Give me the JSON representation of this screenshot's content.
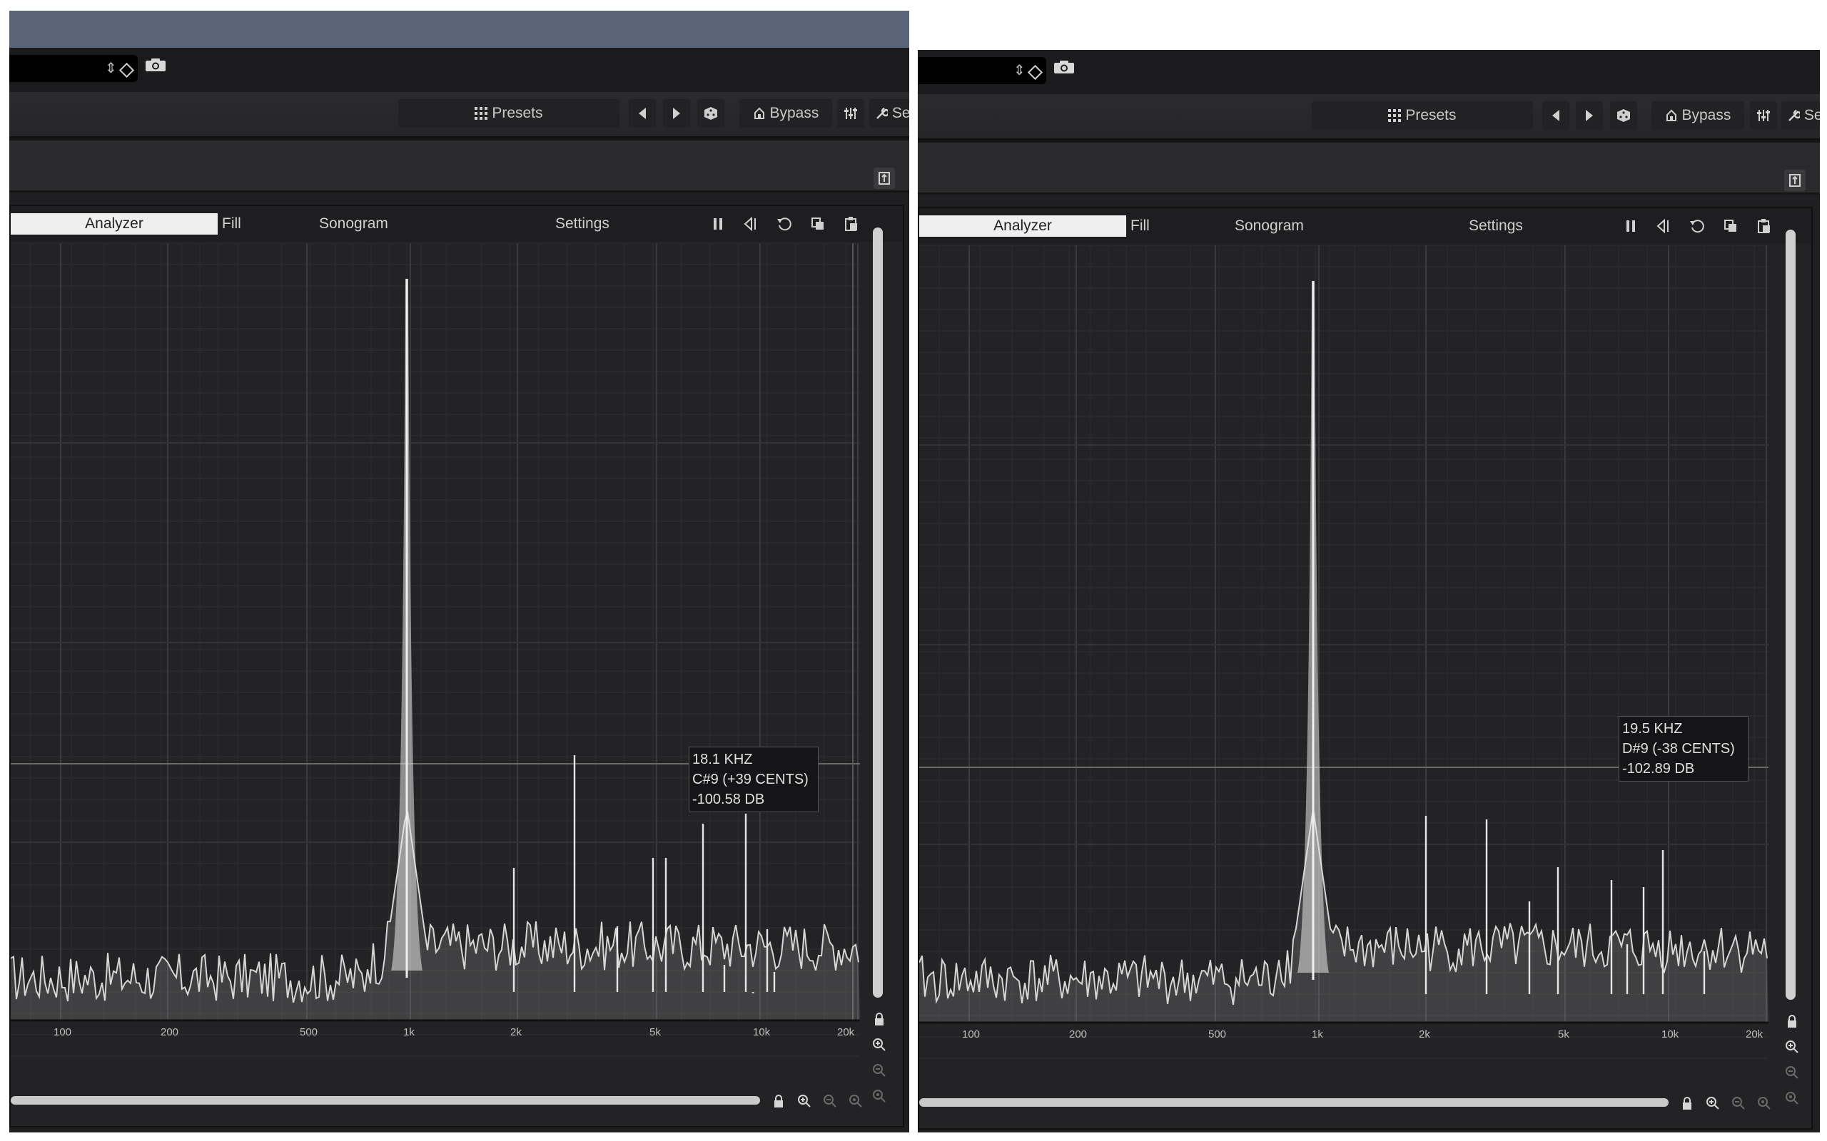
{
  "toolbar": {
    "presets_label": "Presets",
    "bypass_label": "Bypass",
    "settings_short_label": "Set",
    "settings_short_label_right": "Se"
  },
  "tabs": {
    "analyzer": "Analyzer",
    "fill": "Fill",
    "sonogram": "Sonogram",
    "settings": "Settings"
  },
  "x_axis_labels": [
    "100",
    "200",
    "500",
    "1k",
    "2k",
    "5k",
    "10k",
    "20k"
  ],
  "left_panel": {
    "readout": {
      "freq": "18.1 KHZ",
      "note": "C#9 (+39 CENTS)",
      "level": "-100.58 DB"
    }
  },
  "right_panel": {
    "readout": {
      "freq": "19.5 KHZ",
      "note": "D#9 (-38 CENTS)",
      "level": "-102.89 DB"
    }
  },
  "colors": {
    "background": "#232325",
    "trace": "#d9d9d9",
    "active_tab": "#efefef"
  }
}
